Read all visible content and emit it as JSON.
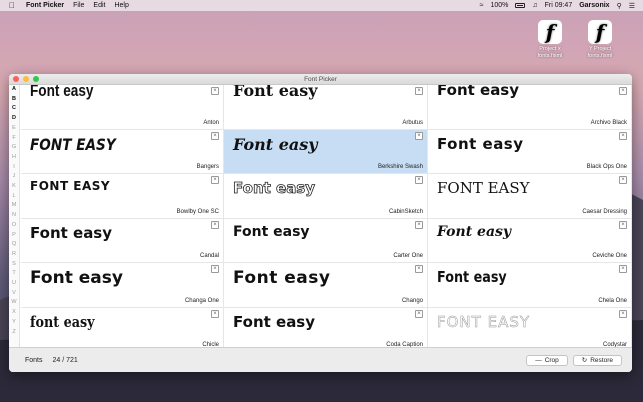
{
  "menubar": {
    "app_name": "Font Picker",
    "menus": [
      "File",
      "Edit",
      "Help"
    ],
    "battery": "100%",
    "clock": "Fri 09:47",
    "user": "Garsonix"
  },
  "desktop": {
    "icons": [
      {
        "line1": "Project x",
        "line2": "fonts.fixml"
      },
      {
        "line1": "Y Project",
        "line2": "fonts.fixml"
      }
    ]
  },
  "window": {
    "title": "Font Picker",
    "alphabet": [
      "A",
      "B",
      "C",
      "D",
      "E",
      "F",
      "G",
      "H",
      "I",
      "J",
      "K",
      "L",
      "M",
      "N",
      "O",
      "P",
      "Q",
      "R",
      "S",
      "T",
      "U",
      "V",
      "W",
      "X",
      "Y",
      "Z"
    ],
    "active_letters": [
      "A",
      "B",
      "C",
      "D"
    ],
    "fonts": [
      {
        "name": "Anton",
        "sample": "Font easy",
        "style": "condensed"
      },
      {
        "name": "Arbutus",
        "sample": "Font easy",
        "style": "slab"
      },
      {
        "name": "Archivo Black",
        "sample": "Font easy",
        "style": "black"
      },
      {
        "name": "Bangers",
        "sample": "FONT EASY",
        "style": "bangers"
      },
      {
        "name": "Berkshire Swash",
        "sample": "Font easy",
        "style": "swash"
      },
      {
        "name": "Black Ops One",
        "sample": "Font easy",
        "style": "stencil"
      },
      {
        "name": "Bowlby One SC",
        "sample": "FONT EASY",
        "style": "wide"
      },
      {
        "name": "CabinSketch",
        "sample": "Font easy",
        "style": "sketch"
      },
      {
        "name": "Caesar Dressing",
        "sample": "FONT EASY",
        "style": "dressing"
      },
      {
        "name": "Candal",
        "sample": "Font easy",
        "style": "candal"
      },
      {
        "name": "Carter One",
        "sample": "Font easy",
        "style": "carter"
      },
      {
        "name": "Ceviche One",
        "sample": "Font easy",
        "style": "ceviche"
      },
      {
        "name": "Changa One",
        "sample": "Font easy",
        "style": "changa"
      },
      {
        "name": "Chango",
        "sample": "Font easy",
        "style": "chango"
      },
      {
        "name": "Chela One",
        "sample": "Font easy",
        "style": "chela"
      },
      {
        "name": "Chicle",
        "sample": "font easy",
        "style": "chicle"
      },
      {
        "name": "Coda Caption",
        "sample": "Font easy",
        "style": "coda"
      },
      {
        "name": "Codystar",
        "sample": "FONT EASY",
        "style": "codystar"
      }
    ],
    "selected_font": "Berkshire Swash",
    "footer": {
      "label": "Fonts",
      "count": "24 / 721",
      "crop_label": "Crop",
      "restore_label": "Restore"
    }
  }
}
